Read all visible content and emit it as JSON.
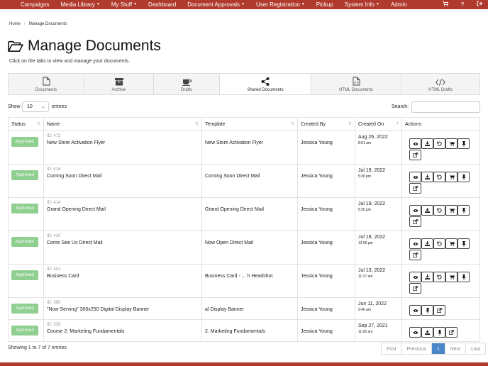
{
  "nav": {
    "items": [
      {
        "label": "Campaigns",
        "caret": false
      },
      {
        "label": "Media Library",
        "caret": true
      },
      {
        "label": "My Stuff",
        "caret": true
      },
      {
        "label": "Dashboard",
        "caret": false
      },
      {
        "label": "Document Approvals",
        "caret": true
      },
      {
        "label": "User Registration",
        "caret": true
      },
      {
        "label": "Pickup",
        "caret": false
      },
      {
        "label": "System Info",
        "caret": true
      },
      {
        "label": "Admin",
        "caret": false
      }
    ],
    "cart_icon": "cart-icon",
    "help_label": "?",
    "logout_icon": "logout-icon"
  },
  "breadcrumb": {
    "home": "Home",
    "current": "Manage Documents"
  },
  "page": {
    "title": "Manage Documents",
    "subtitle": "Click on the tabs to view and manage your documents."
  },
  "tabs": [
    {
      "label": "Documents",
      "icon": "document-icon",
      "active": false
    },
    {
      "label": "Archive",
      "icon": "archive-icon",
      "active": false
    },
    {
      "label": "Drafts",
      "icon": "coffee-icon",
      "active": false
    },
    {
      "label": "Shared Documents",
      "icon": "share-icon",
      "active": true
    },
    {
      "label": "HTML Documents",
      "icon": "code-file-icon",
      "active": false
    },
    {
      "label": "HTML Drafts",
      "icon": "code-icon",
      "active": false
    }
  ],
  "controls": {
    "show_label": "Show",
    "page_size": "10",
    "entries_label": "entries",
    "search_label": "Search:"
  },
  "table": {
    "headers": [
      "Status",
      "Name",
      "Template",
      "Created By",
      "Created On",
      "Actions"
    ],
    "rows": [
      {
        "status": "Approved",
        "id": "ID: 472",
        "name": "New Store Activation Flyer",
        "template": "New Store Activation Flyer",
        "created_by": "Jessica Young",
        "date": "Aug 26, 2022",
        "time": "8:01 am",
        "actions": [
          "eye",
          "download",
          "undo",
          "cart",
          "pin",
          "share"
        ]
      },
      {
        "status": "Approved",
        "id": "ID: 416",
        "name": "Coming Soon Direct Mail",
        "template": "Coming Soon Direct Mail",
        "created_by": "Jessica Young",
        "date": "Jul 19, 2022",
        "time": "5:36 pm",
        "actions": [
          "eye",
          "download",
          "undo",
          "cart",
          "pin",
          "share"
        ]
      },
      {
        "status": "Approved",
        "id": "ID: 414",
        "name": "Grand Opening Direct Mail",
        "template": "Grand Opening Direct Mail",
        "created_by": "Jessica Young",
        "date": "Jul 19, 2022",
        "time": "5:35 pm",
        "actions": [
          "eye",
          "download",
          "undo",
          "cart",
          "pin",
          "share"
        ]
      },
      {
        "status": "Approved",
        "id": "ID: 410",
        "name": "Come See Us Direct Mail",
        "template": "Now Open Direct Mail",
        "created_by": "Jessica Young",
        "date": "Jul 18, 2022",
        "time": "12:56 pm",
        "actions": [
          "eye",
          "download",
          "undo",
          "cart",
          "pin",
          "share"
        ]
      },
      {
        "status": "Approved",
        "id": "ID: 404",
        "name": "Business Card",
        "template": "Business Card - ... h Headshot",
        "created_by": "Jessica Young",
        "date": "Jul 13, 2022",
        "time": "11:17 am",
        "actions": [
          "eye",
          "download",
          "undo",
          "cart",
          "pin",
          "share"
        ]
      },
      {
        "status": "Approved",
        "id": "ID: 385",
        "name": "\"Now Serving\" 300x250 Digital Display Banner",
        "template": "al Display Banner",
        "created_by": "Jessica Young",
        "date": "Jun 11, 2022",
        "time": "9:46 am",
        "actions": [
          "eye",
          "pin",
          "share"
        ]
      },
      {
        "status": "Approved",
        "id": "ID: 326",
        "name": "Course 2: Marketing Fundamentals",
        "template": "2. Marketing Fundamentals",
        "created_by": "Jessica Young",
        "date": "Sep 27, 2021",
        "time": "11:00 am",
        "actions": [
          "eye",
          "download",
          "pin",
          "share"
        ]
      }
    ]
  },
  "footer": {
    "info": "Showing 1 to 7 of 7 entries"
  },
  "pager": {
    "first": "First",
    "previous": "Previous",
    "current": "1",
    "next": "Next",
    "last": "Last"
  },
  "colors": {
    "brand": "#b03a2e",
    "approved": "#8fcf8f",
    "pager_active": "#4a86c8"
  }
}
